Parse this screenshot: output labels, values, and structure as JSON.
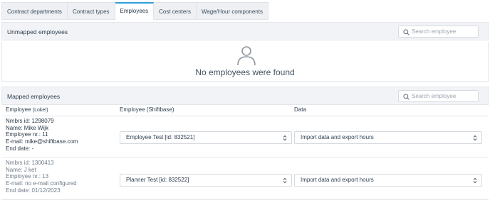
{
  "tabs": [
    "Contract departments",
    "Contract types",
    "Employees",
    "Cost centers",
    "Wage/Hour components"
  ],
  "unmapped": {
    "title": "Unmapped employees",
    "search_placeholder": "Search employee",
    "empty_message": "No employees were found"
  },
  "mapped": {
    "title": "Mapped employees",
    "search_placeholder": "Search employee",
    "columns": {
      "employee": "Employee",
      "employee_suffix": "(Loket)",
      "shiftbase": "Employee (Shiftbase)",
      "data": "Data"
    },
    "rows": [
      {
        "nmbrs_id": "Nmbrs id: 1298079",
        "name": "Name: Mike Wijk",
        "employee_nr": "Employee nr.: 11",
        "email": "E-mail: mike@shiftbase.com",
        "end_date": "End date: -",
        "shiftbase_employee": "Employee Test [id: 832521]",
        "data_option": "Import data and export hours"
      },
      {
        "nmbrs_id": "Nmbrs id: 1300413",
        "name": "Name: J ket",
        "employee_nr": "Employee nr.: 13",
        "email": "E-mail: no e-mail configured",
        "end_date": "End date: 01/12/2023",
        "shiftbase_employee": "Planner Test [id: 832522]",
        "data_option": "Import data and export hours"
      }
    ]
  },
  "icons": {
    "search": "search-icon",
    "person": "person-icon",
    "select": "updown-chevron-icon"
  },
  "colors": {
    "accent": "#2e9bd6",
    "header_bg": "#f1f3f6"
  }
}
